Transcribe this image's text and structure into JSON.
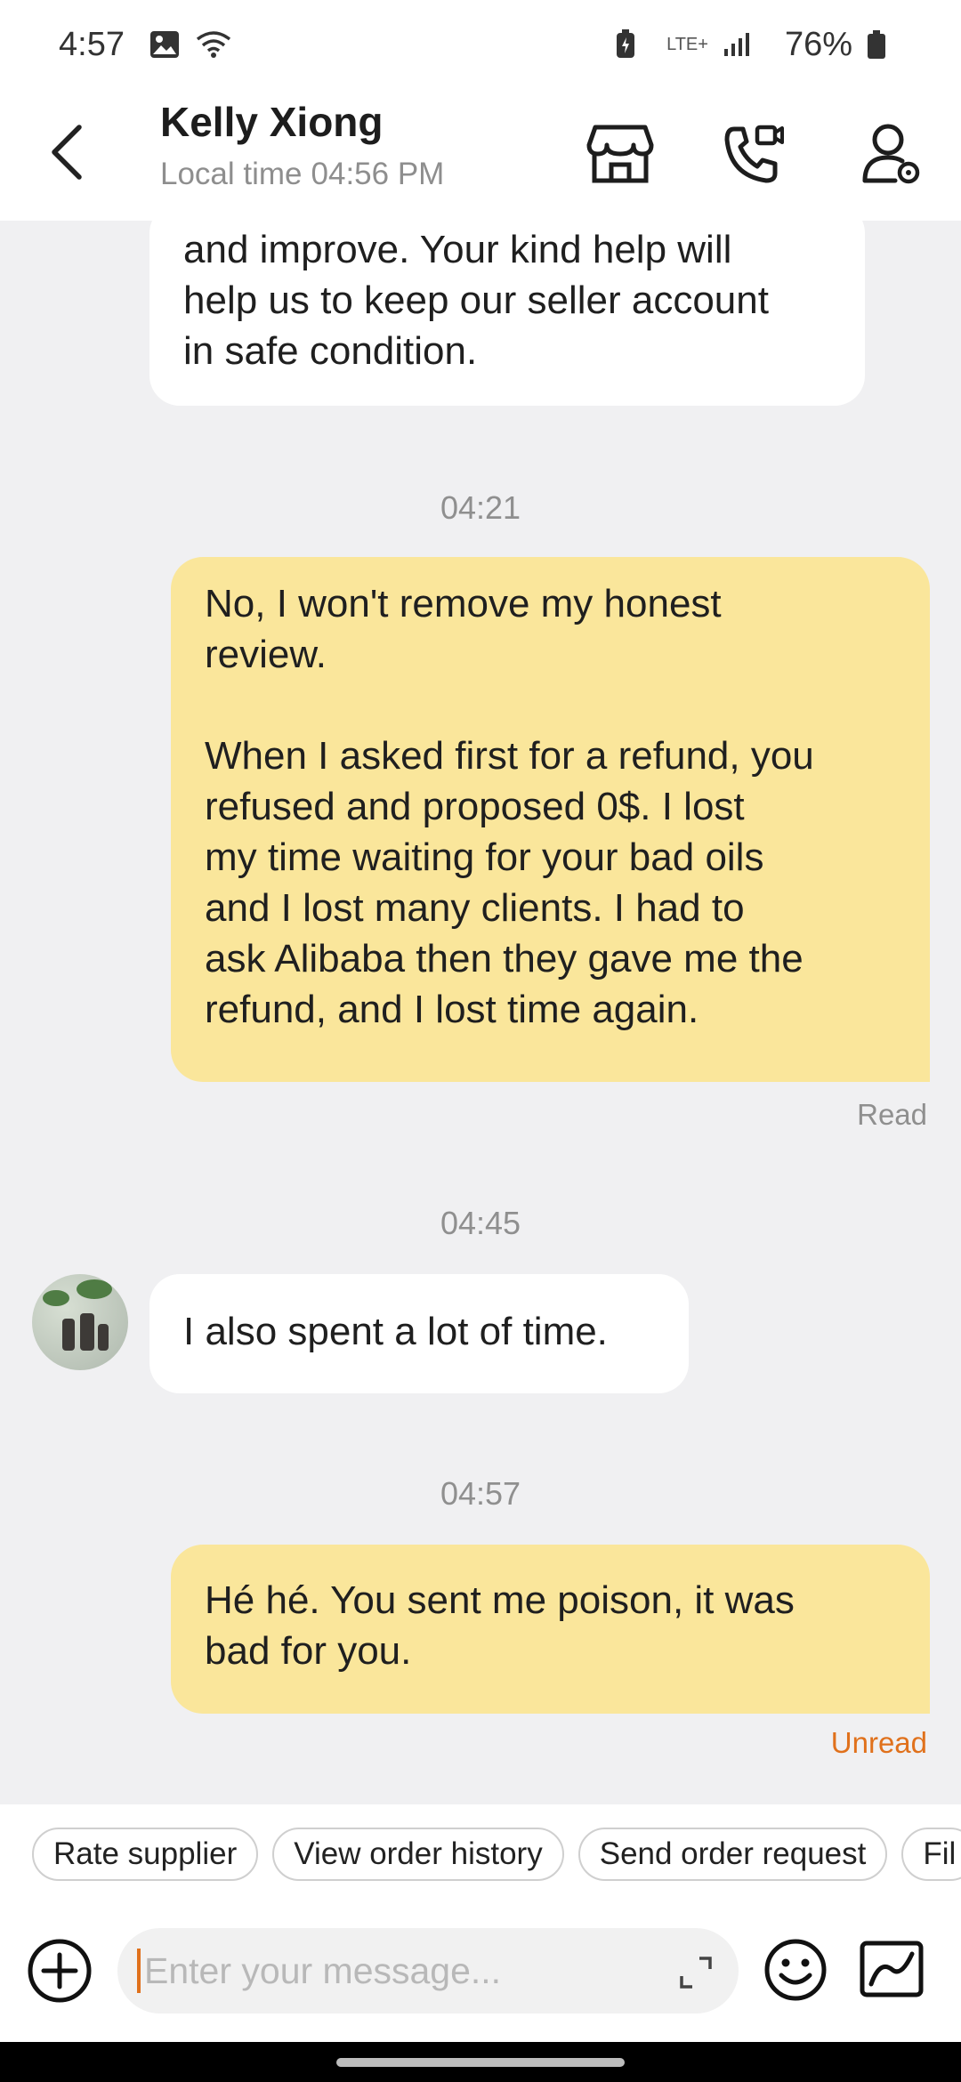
{
  "status_bar": {
    "time": "4:57",
    "network": "LTE+",
    "battery": "76%"
  },
  "header": {
    "contact_name": "Kelly Xiong",
    "local_time_label": "Local time",
    "local_time": "04:56 PM",
    "icons": [
      "back-arrow-icon",
      "store-icon",
      "video-call-icon",
      "contact-profile-icon"
    ]
  },
  "messages": [
    {
      "direction": "incoming",
      "text": "and improve. Your kind help will\nhelp us to keep our seller account\nin safe condition."
    },
    {
      "timestamp": "04:21",
      "direction": "outgoing",
      "text": "No, I won't remove my honest\nreview.\n\nWhen I asked first for a refund, you\nrefused and proposed 0$. I lost\nmy time waiting for your bad oils\nand I lost many clients. I had to\nask Alibaba then they gave me the\nrefund, and I lost time again.",
      "status": "Read"
    },
    {
      "timestamp": "04:45",
      "direction": "incoming",
      "text": "I also spent a lot of time."
    },
    {
      "timestamp": "04:57",
      "direction": "outgoing",
      "text": "Hé hé. You sent me poison, it was\nbad for you.",
      "status": "Unread"
    }
  ],
  "quick_actions": [
    "Rate supplier",
    "View order history",
    "Send order request",
    "Fil"
  ],
  "composer": {
    "placeholder": "Enter your message..."
  },
  "colors": {
    "outgoing_bubble": "#fae69b",
    "incoming_bubble": "#ffffff",
    "chat_background": "#f0f0f2",
    "accent": "#e0711c"
  }
}
